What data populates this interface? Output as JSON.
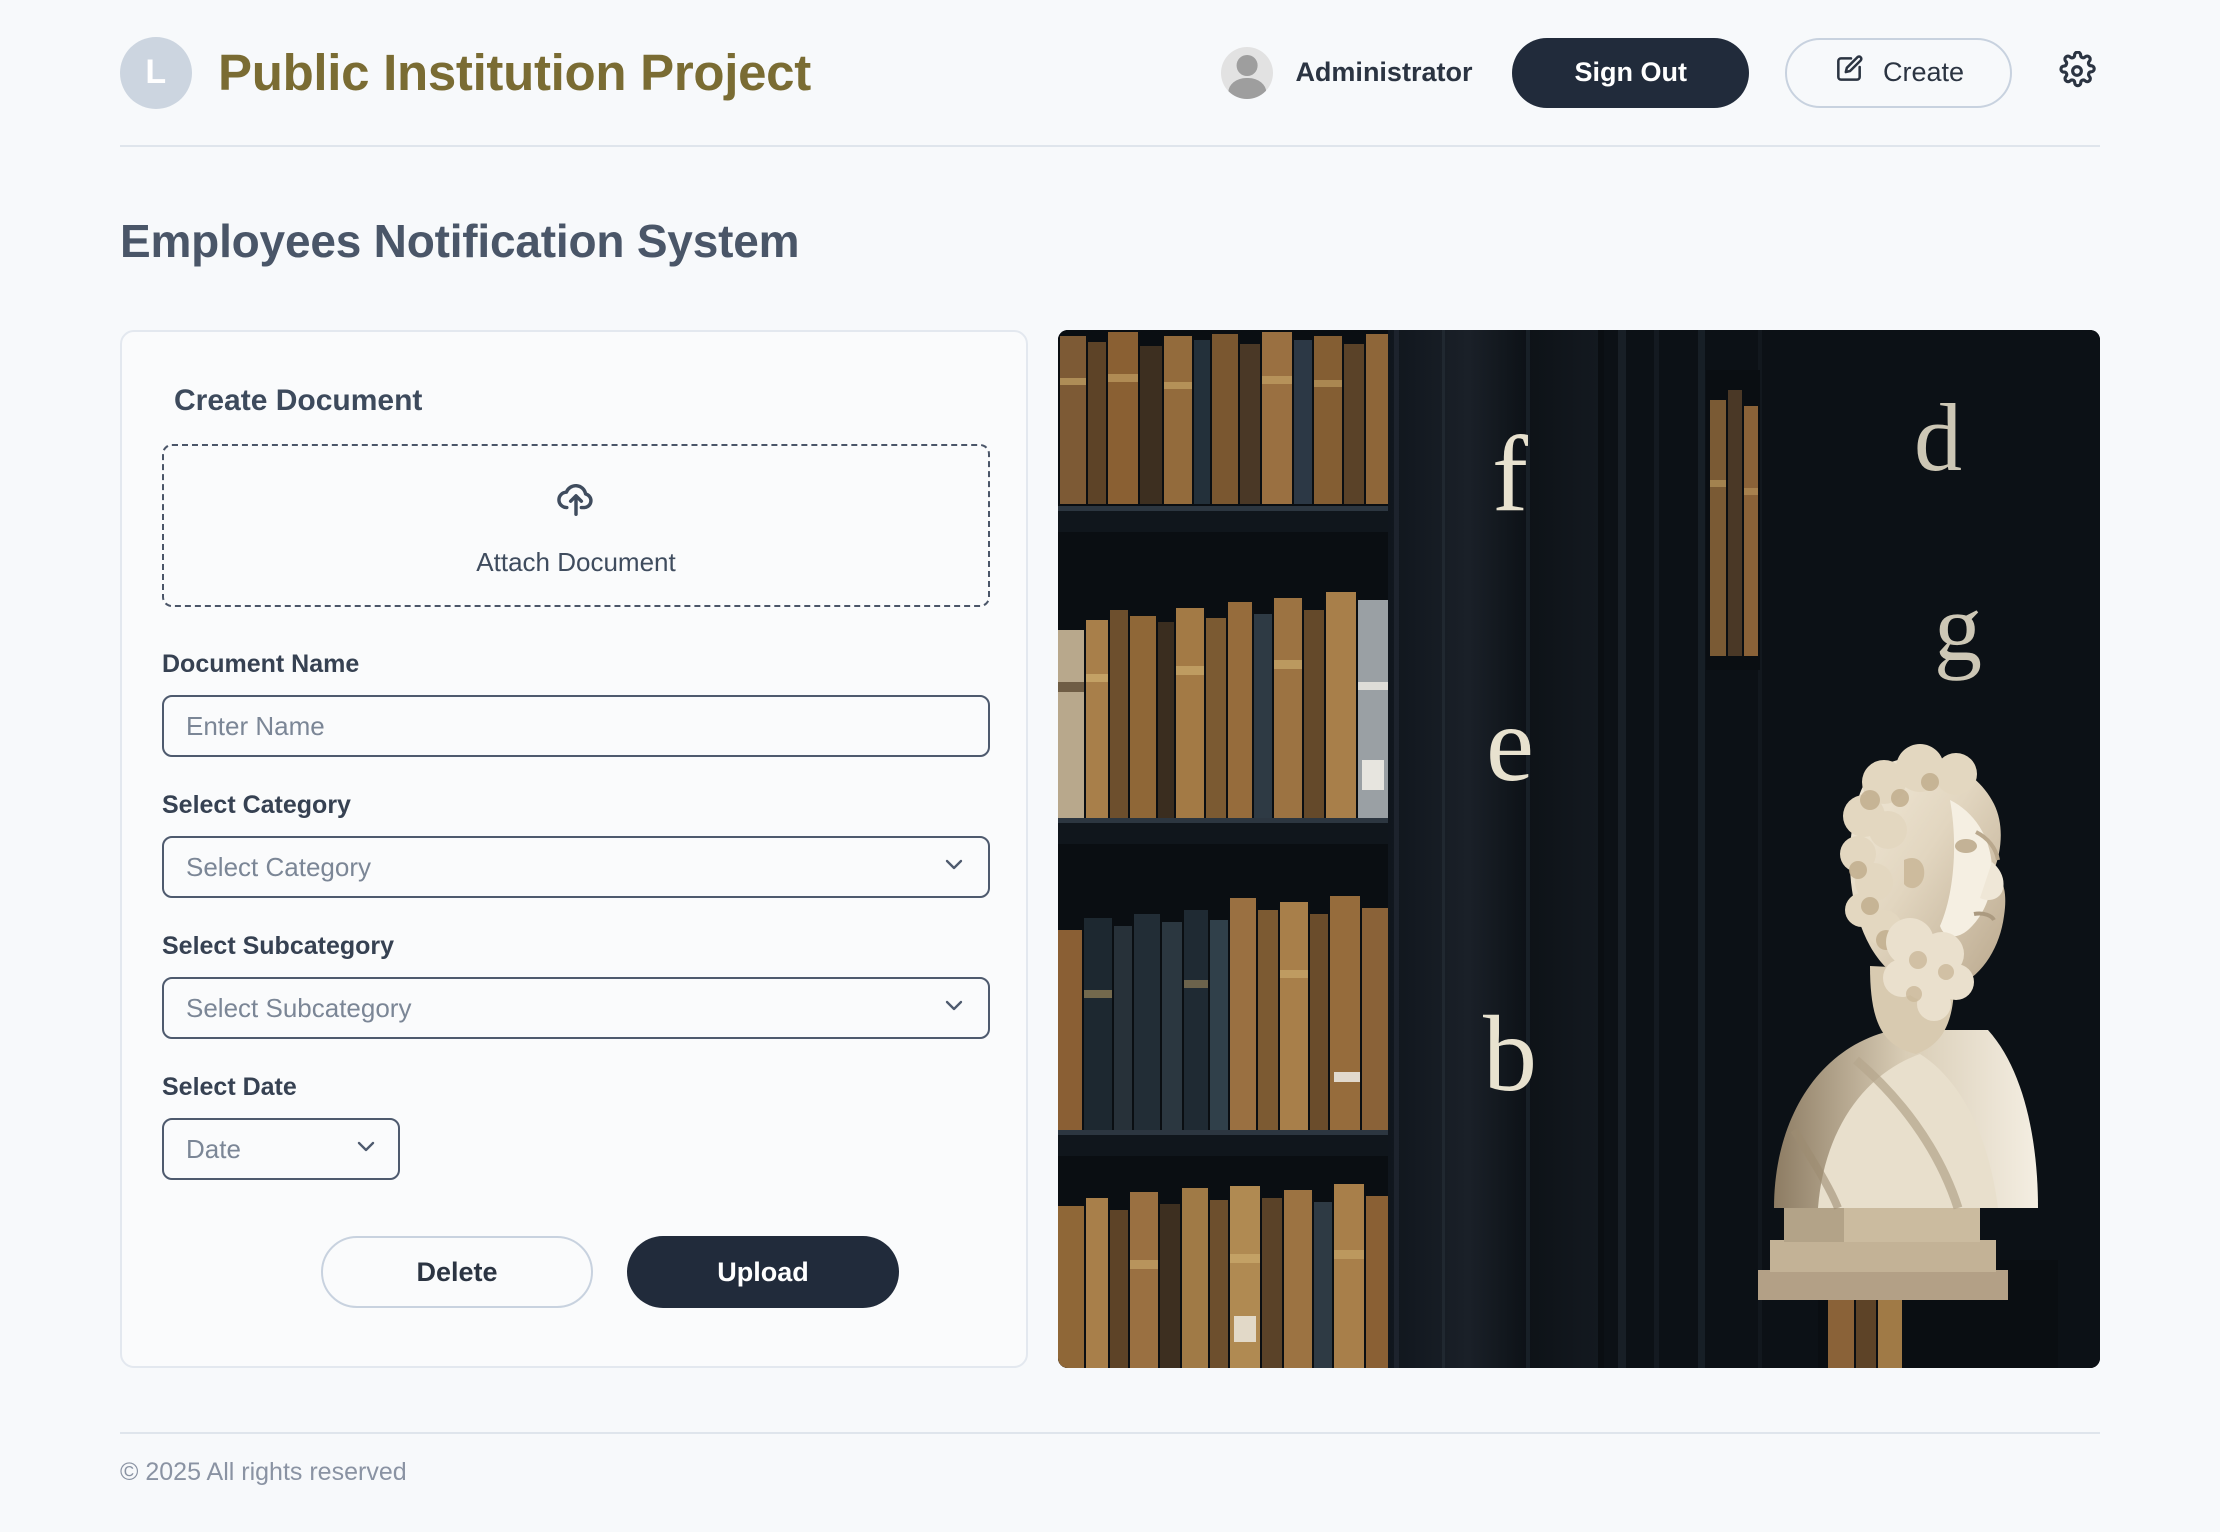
{
  "header": {
    "logo_letter": "L",
    "brand_title": "Public Institution Project",
    "user_name": "Administrator",
    "sign_out_label": "Sign Out",
    "create_label": "Create",
    "icons": {
      "avatar": "avatar-icon",
      "create": "edit-square-icon",
      "settings": "gear-icon"
    }
  },
  "page": {
    "title": "Employees Notification System"
  },
  "form": {
    "card_heading": "Create Document",
    "dropzone": {
      "label": "Attach Document",
      "icon": "cloud-upload-icon"
    },
    "fields": [
      {
        "label": "Document Name",
        "type": "text",
        "value": "",
        "placeholder": "Enter Name"
      },
      {
        "label": "Select Category",
        "type": "select",
        "value": "Select Category",
        "placeholder": "Select Category"
      },
      {
        "label": "Select Subcategory",
        "type": "select",
        "value": "Select Subcategory",
        "placeholder": "Select Subcategory"
      },
      {
        "label": "Select Date",
        "type": "select",
        "value": "Date",
        "placeholder": "Date"
      }
    ],
    "actions": {
      "delete_label": "Delete",
      "upload_label": "Upload"
    }
  },
  "photo": {
    "description": "Old library bookshelves with leather-bound books and a marble bust of a bearded philosopher",
    "gilt_letters": [
      "f",
      "e",
      "b",
      "d",
      "g"
    ]
  },
  "footer": {
    "copyright": "© 2025 All rights reserved"
  },
  "colors": {
    "page_bg": "#f7f9fb",
    "brand_gold": "#7a6c33",
    "dark_navy": "#212b3b",
    "title_slate": "#4a5668",
    "border_light": "#e3e8ef",
    "muted_text": "#8a93a3"
  }
}
